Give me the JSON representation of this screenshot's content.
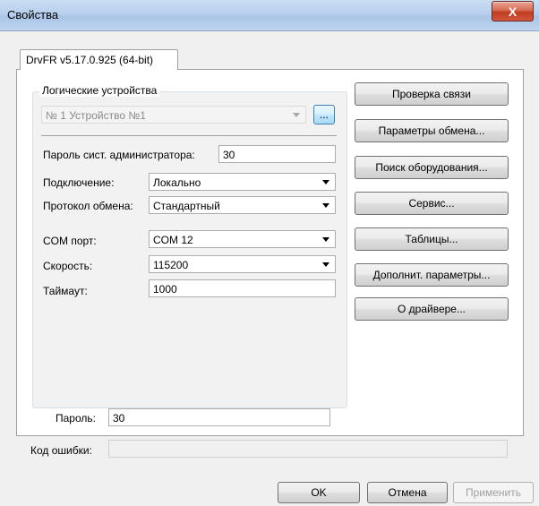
{
  "window": {
    "title": "Свойства",
    "close_glyph": "X"
  },
  "tab": {
    "label": "DrvFR v5.17.0.925 (64-bit)"
  },
  "group": {
    "legend": "Логические устройства",
    "device_combo": "№ 1 Устройство №1",
    "browse_label": "..."
  },
  "fields": {
    "admin_password_label": "Пароль сист. администратора:",
    "admin_password_value": "30",
    "connection_label": "Подключение:",
    "connection_value": "Локально",
    "protocol_label": "Протокол обмена:",
    "protocol_value": "Стандартный",
    "com_port_label": "COM порт:",
    "com_port_value": "COM 12",
    "speed_label": "Скорость:",
    "speed_value": "115200",
    "timeout_label": "Таймаут:",
    "timeout_value": "1000"
  },
  "buttons": {
    "check_connection": "Проверка связи",
    "exchange_params": "Параметры обмена...",
    "find_equipment": "Поиск оборудования...",
    "service": "Сервис...",
    "tables": "Таблицы...",
    "additional_params": "Дополнит. параметры...",
    "about_driver": "О драйвере..."
  },
  "bottom": {
    "password_label": "Пароль:",
    "password_value": "30",
    "error_code_label": "Код ошибки:",
    "error_code_value": ""
  },
  "dialog_buttons": {
    "ok": "OK",
    "cancel": "Отмена",
    "apply": "Применить"
  }
}
